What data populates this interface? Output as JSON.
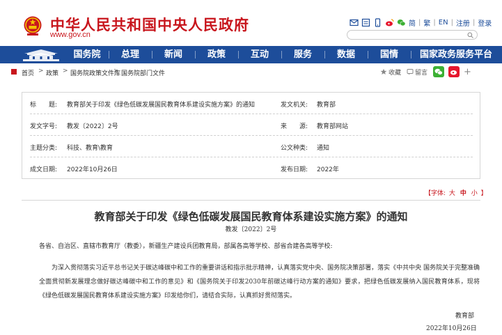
{
  "header": {
    "site_title": "中华人民共和国中央人民政府",
    "site_url": "www.gov.cn",
    "top_links": [
      "简",
      "繁",
      "EN",
      "注册",
      "登录"
    ],
    "search_placeholder": ""
  },
  "nav": {
    "items": [
      "国务院",
      "总理",
      "新闻",
      "政策",
      "互动",
      "服务",
      "数据",
      "国情",
      "国家政务服务平台"
    ]
  },
  "breadcrumb": {
    "items": [
      "首页",
      "政策",
      "国务院政策文件库",
      "国务院部门文件"
    ],
    "arrow": ">",
    "tools": {
      "favorite": "收藏",
      "print": "留言"
    }
  },
  "info": {
    "title_label": "标　　题:",
    "title_value": "教育部关于印发《绿色低碳发展国民教育体系建设实施方案》的通知",
    "issuer_label": "发文机关:",
    "issuer_value": "教育部",
    "docno_label": "发文字号:",
    "docno_value": "教发〔2022〕2号",
    "source_label": "来　　源:",
    "source_value": "教育部网站",
    "topic_label": "主题分类:",
    "topic_value": "科技、教育\\教育",
    "type_label": "公文种类:",
    "type_value": "通知",
    "date_label": "成文日期:",
    "date_value": "2022年10月26日",
    "pubdate_label": "发布日期:",
    "pubdate_value": "2022年"
  },
  "fontsize": {
    "open": "【字体:",
    "options": [
      "大",
      "中",
      "小"
    ],
    "close": "】",
    "active": "中"
  },
  "article": {
    "title": "教育部关于印发《绿色低碳发展国民教育体系建设实施方案》的通知",
    "docno": "教发〔2022〕2号",
    "addressee": "各省、自治区、直辖市教育厅（教委），新疆生产建设兵团教育局，部属各高等学校、部省合建各高等学校:",
    "body": "为深入贯彻落实习近平总书记关于碳达峰碳中和工作的重要讲话和指示批示精神，认真落实党中央、国务院决策部署，落实《中共中央 国务院关于完整准确全面贯彻新发展理念做好碳达峰碳中和工作的意见》和《国务院关于印发2030年前碳达峰行动方案的通知》要求，把绿色低碳发展纳入国民教育体系，现将《绿色低碳发展国民教育体系建设实施方案》印发给你们，请结合实际，认真抓好贯彻落实。",
    "signer": "教育部",
    "sign_date": "2022年10月26日"
  },
  "colors": {
    "brand_red": "#c8161d",
    "nav_blue": "#1d4d9a"
  }
}
